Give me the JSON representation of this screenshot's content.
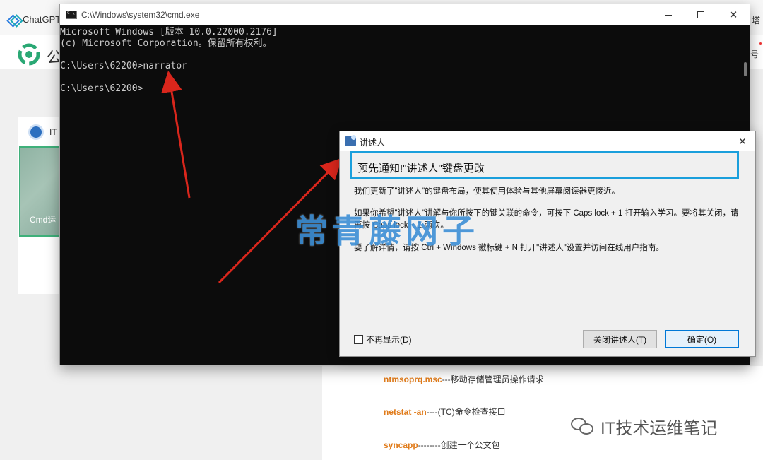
{
  "background": {
    "tab_label": "ChatGPT",
    "tab_right_text": "塔",
    "logo_text": "公",
    "header_right_text": "号",
    "left_card_title": "IT",
    "left_thumb_text": "Cmd运",
    "article_lines": [
      {
        "cmd": "ntmsoprq.msc",
        "desc": "---移动存储管理员操作请求"
      },
      {
        "cmd": "netstat -an",
        "desc": "----(TC)命令检查接口"
      },
      {
        "cmd": "syncapp",
        "desc": "--------创建一个公文包"
      }
    ],
    "wechat_watermark": "IT技术运维笔记"
  },
  "cmd_window": {
    "title": "C:\\Windows\\system32\\cmd.exe",
    "lines": [
      "Microsoft Windows [版本 10.0.22000.2176]",
      "(c) Microsoft Corporation。保留所有权利。",
      "C:\\Users\\62200>narrator",
      "C:\\Users\\62200>"
    ],
    "controls": {
      "minimize": "—",
      "maximize": "☐",
      "close": "✕"
    }
  },
  "narrator_dialog": {
    "title": "讲述人",
    "close_glyph": "✕",
    "heading": "预先通知!\"讲述人\"键盘更改",
    "paragraphs": [
      "我们更新了\"讲述人\"的键盘布局，使其使用体验与其他屏幕阅读器更接近。",
      "如果你希望\"讲述人\"讲解与你所按下的键关联的命令，可按下 Caps lock + 1 打开输入学习。要将其关闭，请再按 Caps lock + 1 两次。",
      "要了解详情，请按 Ctrl + Windows 徽标键 + N 打开\"讲述人\"设置并访问在线用户指南。"
    ],
    "checkbox_label": "不再显示(D)",
    "checkbox_checked": false,
    "buttons": {
      "close_narrator": "关闭讲述人(T)",
      "ok": "确定(O)"
    },
    "accent_color": "#1a9fdc"
  },
  "watermark_text": "常青藤网子",
  "annotation_color": "#d9261c"
}
